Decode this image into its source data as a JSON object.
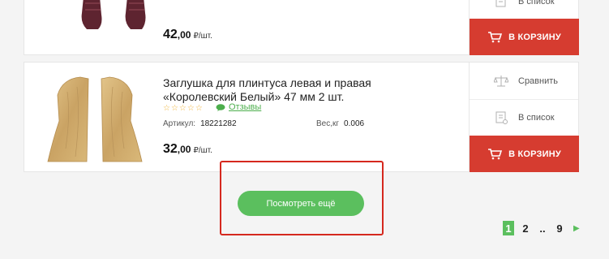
{
  "top_product": {
    "price_int": "42",
    "price_dec": ",00",
    "unit": "₽/шт.",
    "list_label": "В список",
    "cart_label": "В КОРЗИНУ"
  },
  "product": {
    "title": "Заглушка для плинтуса левая и правая «Королевский Белый» 47 мм 2 шт.",
    "stars": "☆☆☆☆☆",
    "reviews_label": "Отзывы",
    "article_label": "Артикул:",
    "article_value": "18221282",
    "weight_label": "Вес,кг",
    "weight_value": "0.006",
    "price_int": "32",
    "price_dec": ",00",
    "unit": "₽/шт.",
    "compare_label": "Сравнить",
    "list_label": "В список",
    "cart_label": "В КОРЗИНУ"
  },
  "load_more": {
    "label": "Посмотреть ещё"
  },
  "pagination": {
    "pages": [
      "1",
      "2",
      "..",
      "9"
    ],
    "active": "1",
    "next_icon": "chevron-right-icon"
  },
  "colors": {
    "accent_green": "#5bbf5e",
    "cart_red": "#d63c30",
    "highlight_red": "#d5281e"
  }
}
